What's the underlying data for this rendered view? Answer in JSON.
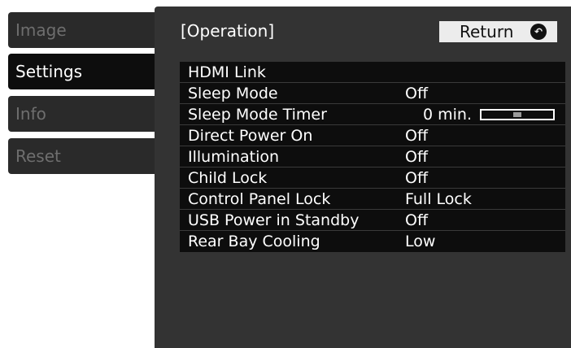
{
  "tabs": [
    {
      "label": "Image",
      "active": false
    },
    {
      "label": "Settings",
      "active": true
    },
    {
      "label": "Info",
      "active": false
    },
    {
      "label": "Reset",
      "active": false
    }
  ],
  "panel": {
    "title": "[Operation]",
    "return_label": "Return",
    "return_icon": "return-arrow-icon"
  },
  "rows": [
    {
      "label": "HDMI Link",
      "value": ""
    },
    {
      "label": "Sleep Mode",
      "value": "Off"
    },
    {
      "label": "Sleep Mode Timer",
      "value": "0 min.",
      "slider_level": 0.5
    },
    {
      "label": "Direct Power On",
      "value": "Off"
    },
    {
      "label": "Illumination",
      "value": "Off"
    },
    {
      "label": "Child Lock",
      "value": "Off"
    },
    {
      "label": "Control Panel Lock",
      "value": "Full Lock"
    },
    {
      "label": "USB Power in Standby",
      "value": "Off"
    },
    {
      "label": "Rear Bay Cooling",
      "value": "Low"
    }
  ],
  "colors": {
    "panel_bg": "#333333",
    "list_bg": "#0d0d0d",
    "active_tab_bg": "#0d0d0d",
    "inactive_tab_bg": "#2a2a2a",
    "inactive_tab_text": "#6e6e6e",
    "return_button_bg": "#ececec"
  }
}
